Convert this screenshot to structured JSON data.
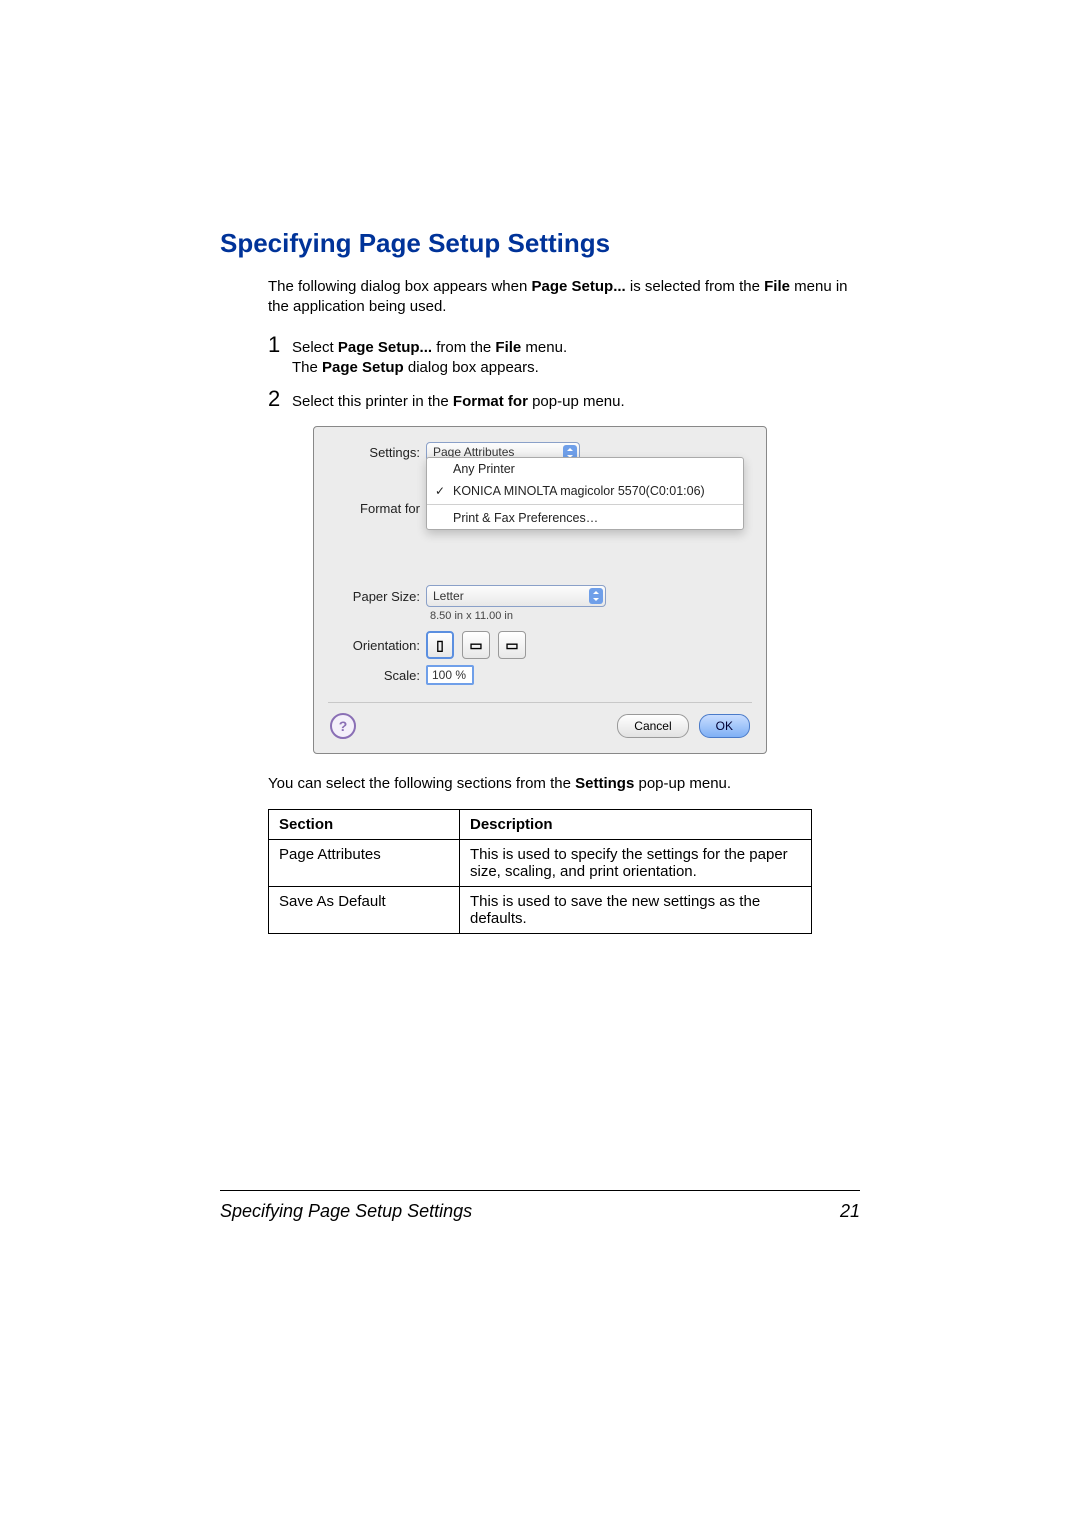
{
  "heading": "Specifying Page Setup Settings",
  "intro": {
    "pre": "The following dialog box appears when ",
    "bold1": "Page Setup...",
    "mid": " is selected from the ",
    "bold2": "File",
    "post": " menu in the application being used."
  },
  "steps": [
    {
      "num": "1",
      "parts": [
        "Select ",
        "Page Setup...",
        " from the ",
        "File",
        " menu."
      ],
      "line2": [
        "The ",
        "Page Setup",
        " dialog box appears."
      ]
    },
    {
      "num": "2",
      "parts": [
        "Select this printer in the ",
        "Format for",
        " pop-up menu."
      ]
    }
  ],
  "dialog": {
    "labels": {
      "settings": "Settings:",
      "format_for": "Format for",
      "paper_size": "Paper Size:",
      "orientation": "Orientation:",
      "scale": "Scale:"
    },
    "settings_value": "Page Attributes",
    "format_for_menu": {
      "items": [
        {
          "label": "Any Printer"
        },
        {
          "label": "KONICA MINOLTA magicolor 5570(C0:01:06)",
          "checked": true
        },
        {
          "label": "Print & Fax Preferences…",
          "sep": true
        }
      ]
    },
    "paper_size_value": "Letter",
    "paper_dim": "8.50 in x 11.00 in",
    "scale_value": "100 %",
    "help_glyph": "?",
    "cancel": "Cancel",
    "ok": "OK"
  },
  "post_text": {
    "pre": "You can select the following sections from the ",
    "bold": "Settings",
    "post": " pop-up menu."
  },
  "table": {
    "headers": {
      "section": "Section",
      "description": "Description"
    },
    "rows": [
      {
        "section": "Page Attributes",
        "description": "This is used to specify the settings for the paper size, scaling, and print orientation."
      },
      {
        "section": "Save As Default",
        "description": "This is used to save the new settings as the defaults."
      }
    ]
  },
  "footer": {
    "title": "Specifying Page Setup Settings",
    "page": "21"
  }
}
